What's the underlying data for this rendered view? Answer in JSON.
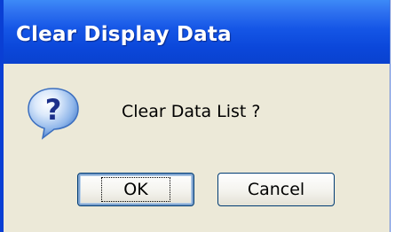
{
  "dialog": {
    "title": "Clear Display Data",
    "message": "Clear Data List ?",
    "icon": "question-icon"
  },
  "buttons": {
    "ok_label": "OK",
    "cancel_label": "Cancel"
  },
  "colors": {
    "titlebar": "#0b47da",
    "body": "#ece9d8",
    "button_border": "#003c74"
  }
}
